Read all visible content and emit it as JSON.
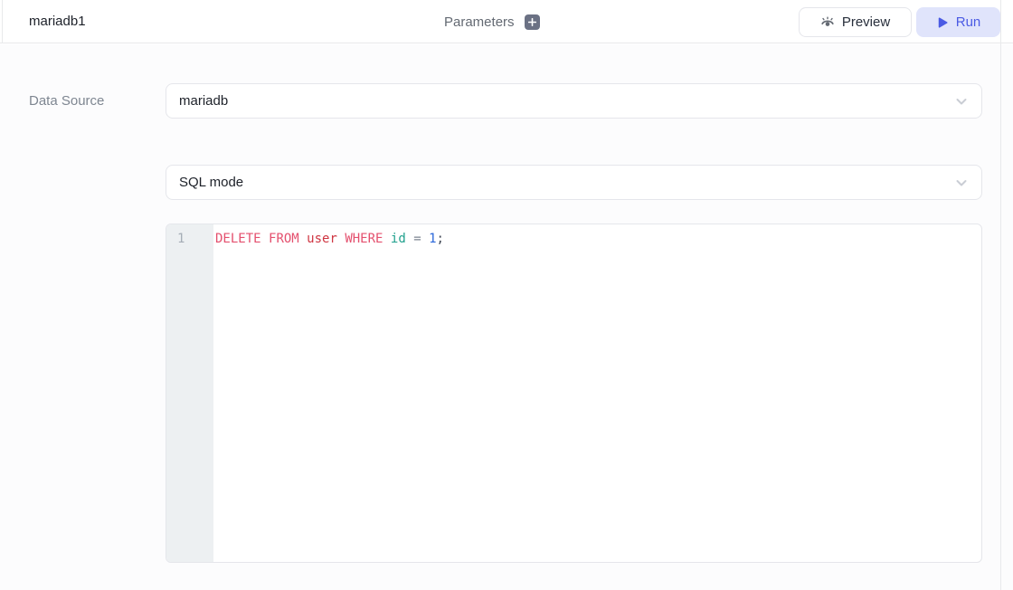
{
  "header": {
    "title": "mariadb1",
    "parameters": {
      "label": "Parameters",
      "add_icon": "plus"
    },
    "preview_button": {
      "label": "Preview",
      "icon": "eye"
    },
    "run_button": {
      "label": "Run",
      "icon": "play"
    }
  },
  "form": {
    "data_source": {
      "label": "Data Source",
      "value": "mariadb"
    },
    "mode_select": {
      "value": "SQL mode"
    }
  },
  "editor": {
    "line_number": "1",
    "code_text": "DELETE FROM user WHERE id = 1;",
    "tokens": [
      {
        "text": "DELETE",
        "type": "keyword"
      },
      {
        "text": " ",
        "type": "plain"
      },
      {
        "text": "FROM",
        "type": "keyword"
      },
      {
        "text": " ",
        "type": "plain"
      },
      {
        "text": "user",
        "type": "table"
      },
      {
        "text": " ",
        "type": "plain"
      },
      {
        "text": "WHERE",
        "type": "keyword"
      },
      {
        "text": " ",
        "type": "plain"
      },
      {
        "text": "id",
        "type": "field"
      },
      {
        "text": " ",
        "type": "plain"
      },
      {
        "text": "=",
        "type": "operator"
      },
      {
        "text": " ",
        "type": "plain"
      },
      {
        "text": "1",
        "type": "number"
      },
      {
        "text": ";",
        "type": "punctuation"
      }
    ]
  },
  "colors": {
    "accent": "#4b5be4",
    "run_button_bg": "#e0e4fb",
    "tokens": {
      "keyword": "#e4506e",
      "table": "#cf3642",
      "field": "#20a08d",
      "operator": "#7e8691",
      "number": "#2c68da",
      "punctuation": "#3f4754"
    }
  }
}
